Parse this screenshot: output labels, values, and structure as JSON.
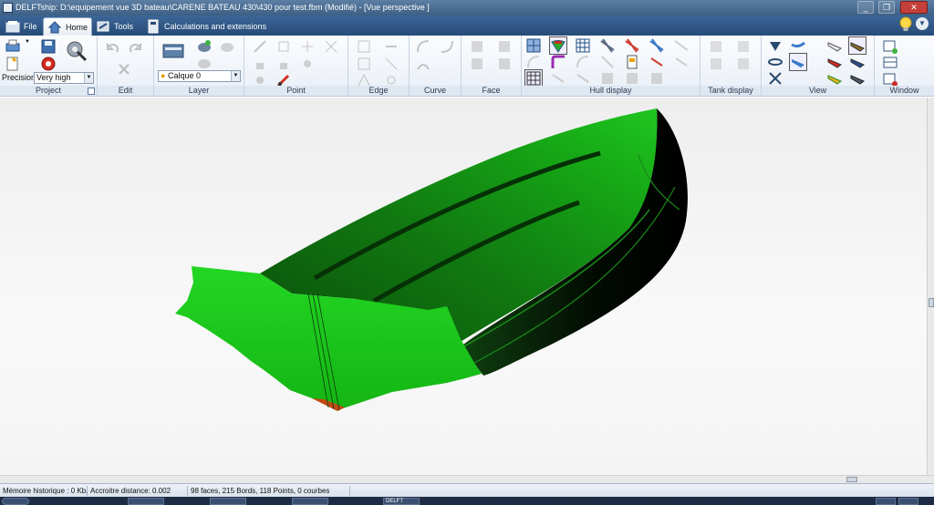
{
  "window": {
    "title": "DELFTship: D:\\equipement vue 3D bateau\\CARENE BATEAU 430\\430 pour test.fbm (Modifié) - [Vue  perspective ]",
    "controls": [
      "_",
      "❐",
      "✕"
    ]
  },
  "menu": {
    "tabs": [
      {
        "label": "File",
        "icon": "file-icon"
      },
      {
        "label": "Home",
        "icon": "home-icon",
        "active": true
      },
      {
        "label": "Tools",
        "icon": "tools-icon"
      },
      {
        "label": "Calculations and extensions",
        "icon": "calculator-icon"
      }
    ]
  },
  "ribbon": {
    "groups": [
      {
        "label": "Project",
        "precision_label": "Precision",
        "precision_value": "Very high"
      },
      {
        "label": "Edit"
      },
      {
        "label": "Layer",
        "layer_value": "Calque 0"
      },
      {
        "label": "Point"
      },
      {
        "label": "Edge"
      },
      {
        "label": "Curve"
      },
      {
        "label": "Face"
      },
      {
        "label": "Hull display"
      },
      {
        "label": "Tank display"
      },
      {
        "label": "View"
      },
      {
        "label": "Window"
      }
    ]
  },
  "status": {
    "memory": "Mémoire historique : 0 Kb.",
    "snap": "Accroitre distance: 0.002",
    "stats": "98 faces, 215 Bords, 118 Points, 0 courbes"
  },
  "taskbar": {
    "item": "DELFT"
  },
  "colors": {
    "hull_green": "#17c317",
    "hull_dark": "#0b3a0b",
    "keel_orange": "#c24a14",
    "ribbon_blue": "#274b78"
  }
}
